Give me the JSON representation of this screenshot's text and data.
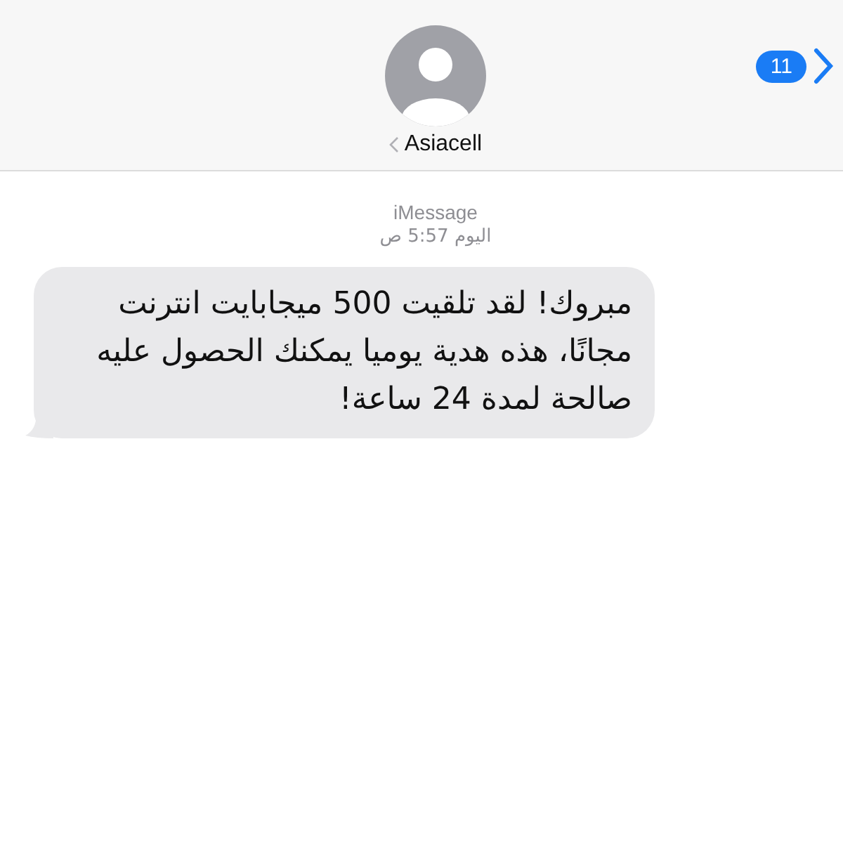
{
  "header": {
    "contact_name": "Asiacell",
    "unread_count": "11"
  },
  "thread": {
    "service": "iMessage",
    "timestamp": "اليوم 5:57 ص"
  },
  "messages": [
    {
      "text": "مبروك! لقد تلقيت 500 ميجابايت انترنت مجانًا، هذه هدية يوميا يمكنك الحصول عليه صالحة لمدة 24 ساعة!",
      "kind": "received"
    }
  ]
}
